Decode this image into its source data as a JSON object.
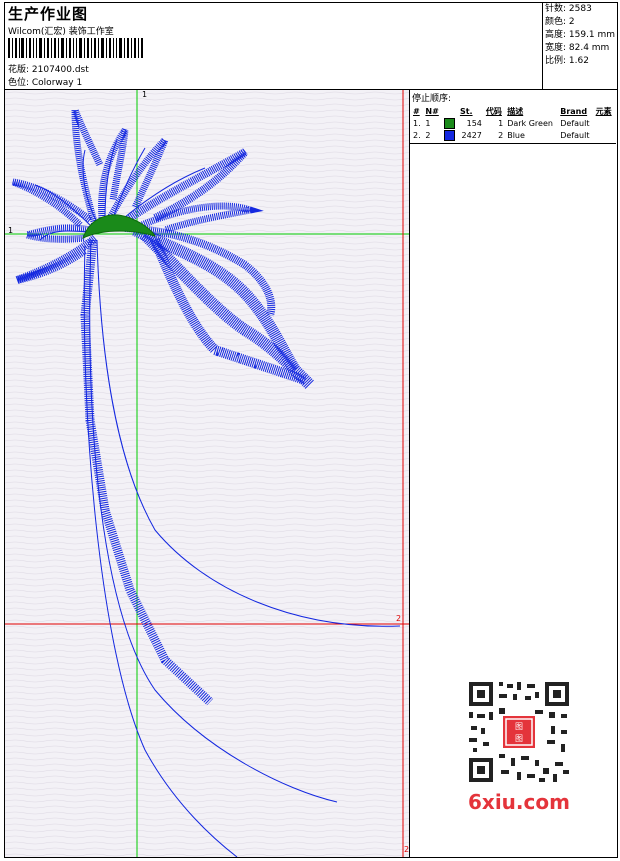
{
  "header": {
    "title": "生产作业图",
    "company": "Wilcom(汇宏) 装饰工作室",
    "design_file": "花版: 2107400.dst",
    "colorway": "色位: Colorway 1"
  },
  "info": {
    "stitches": "针数: 2583",
    "colors": "颜色: 2",
    "height": "高度: 159.1 mm",
    "width": "宽度: 82.4 mm",
    "scale": "比例: 1.62"
  },
  "stop_sequence": {
    "title": "停止顺序:",
    "columns": [
      "#",
      "N#",
      "St.",
      "代码",
      "描述",
      "Brand",
      "元素"
    ],
    "rows": [
      {
        "num": "1.",
        "needle": "1",
        "color": "#1a8a1a",
        "stitches": "154",
        "code": "1",
        "description": "Dark Green",
        "brand": "Default"
      },
      {
        "num": "2.",
        "needle": "2",
        "color": "#1428e0",
        "stitches": "2427",
        "code": "2",
        "description": "Blue",
        "brand": "Default"
      }
    ]
  },
  "canvas": {
    "marker_1_top": "1",
    "marker_1_left": "1",
    "marker_2": "2",
    "marker_2_bottom": "2",
    "crosshair_color": "#00cc00",
    "guide_color": "#e00000",
    "stitch_blue": "#1428e0",
    "stitch_green": "#1a8a1a"
  },
  "watermark": {
    "text": "6xiu.com",
    "color": "#e4343b"
  }
}
